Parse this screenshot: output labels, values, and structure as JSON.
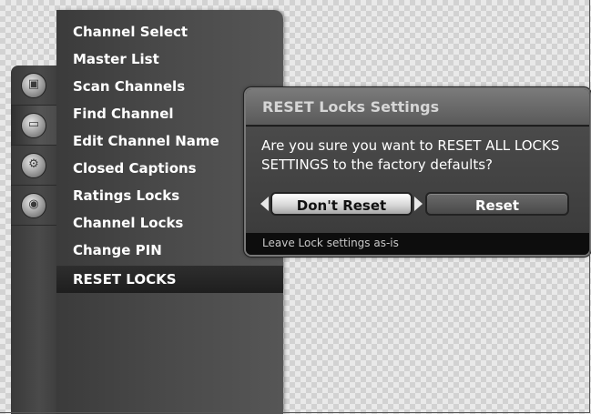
{
  "sidebar_icons": [
    {
      "name": "picture-icon",
      "glyph": "▣"
    },
    {
      "name": "channel-icon",
      "glyph": "▭"
    },
    {
      "name": "settings-icon",
      "glyph": "⚙"
    },
    {
      "name": "camera-icon",
      "glyph": "◉"
    }
  ],
  "menu": {
    "items": [
      {
        "label": "Channel Select"
      },
      {
        "label": "Master List"
      },
      {
        "label": "Scan Channels"
      },
      {
        "label": "Find Channel"
      },
      {
        "label": "Edit Channel Name"
      },
      {
        "label": "Closed Captions"
      },
      {
        "label": "Ratings Locks"
      },
      {
        "label": "Channel Locks"
      },
      {
        "label": "Change PIN"
      },
      {
        "label": "RESET LOCKS"
      }
    ]
  },
  "dialog": {
    "title": "RESET Locks Settings",
    "message": "Are you sure you want to RESET ALL LOCKS SETTINGS to the factory defaults?",
    "dont_reset_label": "Don't Reset",
    "reset_label": "Reset",
    "footer": "Leave Lock settings as-is"
  }
}
